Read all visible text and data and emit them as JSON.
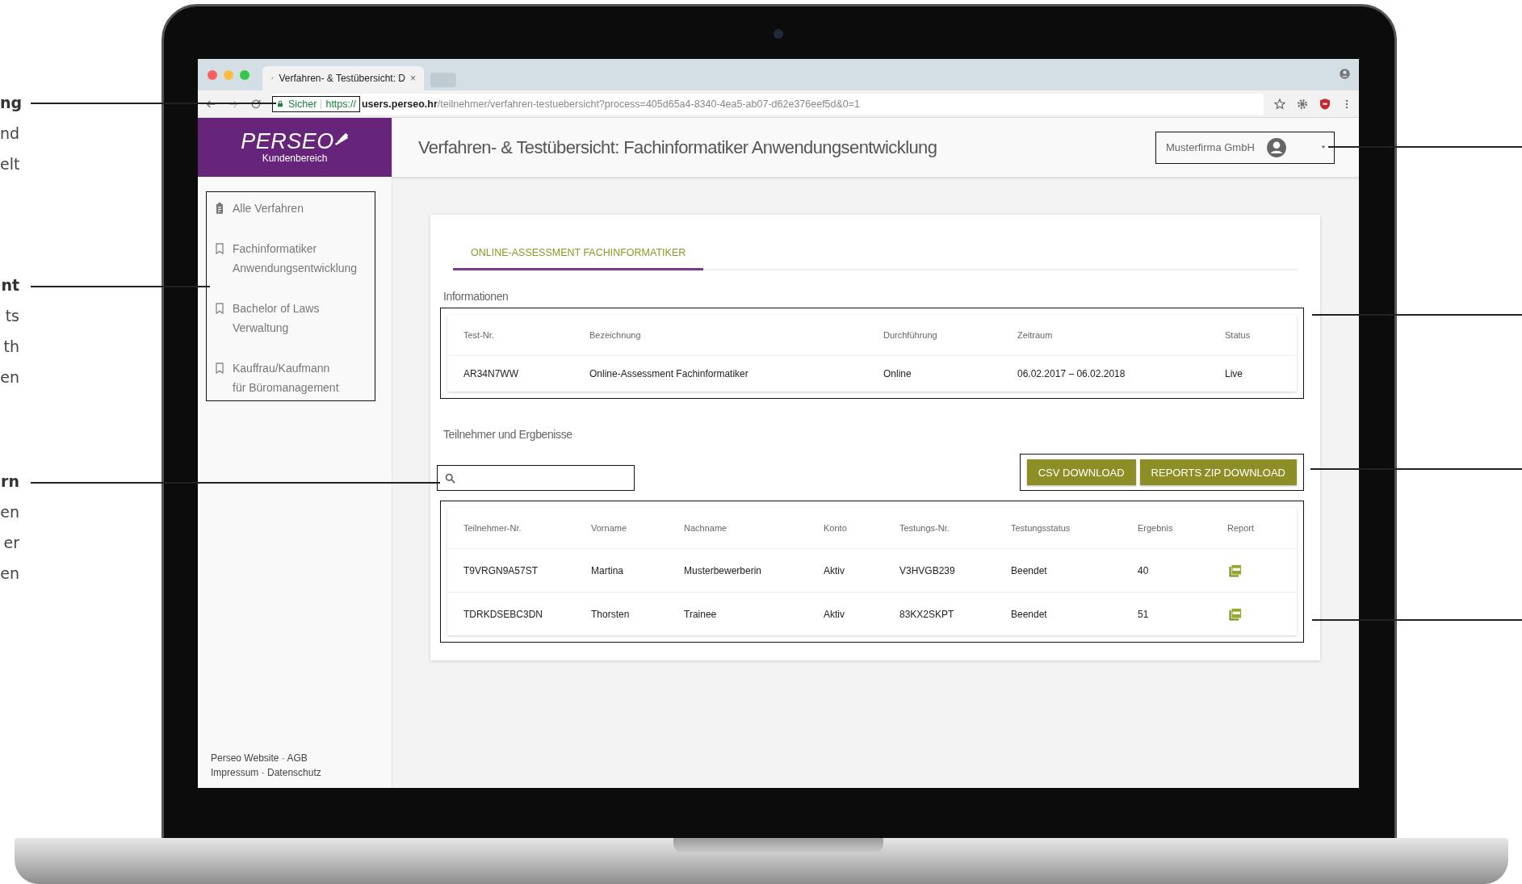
{
  "annotations_left": [
    {
      "lines": [
        "ng",
        "nd",
        "elt"
      ]
    },
    {
      "lines": [
        "nt",
        "ts",
        "th",
        "en"
      ]
    },
    {
      "lines": [
        "rn",
        "en",
        "er",
        "en"
      ]
    }
  ],
  "browser": {
    "tab_title": "Verfahren- & Testübersicht: D",
    "tab_close": "×",
    "secure_label": "Sicher",
    "url_scheme": "https://",
    "url_host": "users.perseo.hr",
    "url_path": "/teilnehmer/verfahren-testuebersicht?process=405d65a4-8340-4ea5-ab07-d62e376eef5d&0=1"
  },
  "logo": {
    "name": "PERSEO",
    "subtitle": "Kundenbereich"
  },
  "sidebar": {
    "items": [
      {
        "kind": "all",
        "lines": [
          "Alle Verfahren"
        ]
      },
      {
        "kind": "procedure",
        "lines": [
          "Fachinformatiker",
          "Anwendungsentwicklung"
        ]
      },
      {
        "kind": "procedure",
        "lines": [
          "Bachelor of Laws",
          "Verwaltung"
        ]
      },
      {
        "kind": "procedure",
        "lines": [
          "Kauffrau/Kaufmann",
          "für Büromanagement"
        ]
      }
    ],
    "footer_rows": [
      [
        "Perseo Website",
        "AGB"
      ],
      [
        "Impressum",
        "Datenschutz"
      ]
    ],
    "footer_separator": "·"
  },
  "page_title": "Verfahren- & Testübersicht: Fachinformatiker Anwendungsentwicklung",
  "user": {
    "name": "Musterfirma GmbH"
  },
  "tabs": [
    {
      "label": "ONLINE-ASSESSMENT FACHINFORMATIKER",
      "selected": true
    }
  ],
  "info": {
    "heading": "Informationen",
    "columns": [
      "Test-Nr.",
      "Bezeichnung",
      "Durchführung",
      "Zeitraum",
      "Status"
    ],
    "rows": [
      [
        "AR34N7WW",
        "Online-Assessment Fachinformatiker",
        "Online",
        "06.02.2017 – 06.02.2018",
        "Live"
      ]
    ]
  },
  "participants": {
    "heading": "Teilnehmer und Ergbenisse",
    "buttons": [
      "CSV DOWNLOAD",
      "REPORTS ZIP DOWNLOAD"
    ],
    "columns": [
      "Teilnehmer-Nr.",
      "Vorname",
      "Nachname",
      "Konto",
      "Testungs-Nr.",
      "Testungsstatus",
      "Ergebnis",
      "Report"
    ],
    "rows": [
      {
        "cells": [
          "T9VRGN9A57ST",
          "Martina",
          "Musterbewerberin",
          "Aktiv",
          "V3HVGB239",
          "Beendet",
          "40"
        ],
        "has_report": true
      },
      {
        "cells": [
          "TDRKDSEBC3DN",
          "Thorsten",
          "Trainee",
          "Aktiv",
          "83KX2SKPT",
          "Beendet",
          "51"
        ],
        "has_report": true
      }
    ]
  }
}
